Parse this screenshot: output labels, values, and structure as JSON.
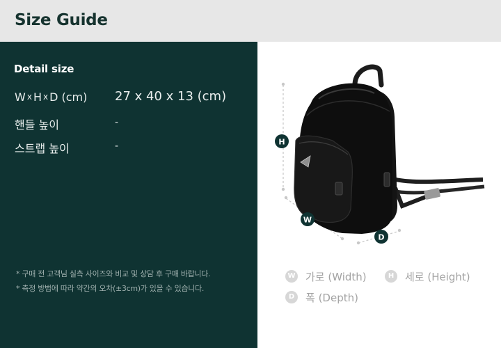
{
  "header": {
    "title": "Size Guide"
  },
  "detail": {
    "title": "Detail size",
    "dims_label": {
      "w": "W",
      "h": "H",
      "d": "D",
      "x": "x",
      "unit": "(cm)"
    },
    "dims_value": "27 x 40 x 13 (cm)",
    "rows": [
      {
        "label": "핸들 높이",
        "value": "-"
      },
      {
        "label": "스트랩 높이",
        "value": "-"
      }
    ]
  },
  "notes": [
    "* 구매 전 고객님 실측 사이즈와 비교 및 상담 후 구매 바랍니다.",
    "* 측정 방법에 따라 약간의 오차(±3cm)가 있을 수 있습니다."
  ],
  "markers": {
    "h": "H",
    "w": "W",
    "d": "D"
  },
  "legend": [
    {
      "badge": "W",
      "text": "가로 (Width)"
    },
    {
      "badge": "H",
      "text": "세로 (Height)"
    },
    {
      "badge": "D",
      "text": "폭 (Depth)"
    }
  ],
  "colors": {
    "header_bg": "#e7e7e7",
    "panel_bg": "#0f3332",
    "marker": "#0f3332",
    "legend_badge": "#d7d7d7"
  }
}
